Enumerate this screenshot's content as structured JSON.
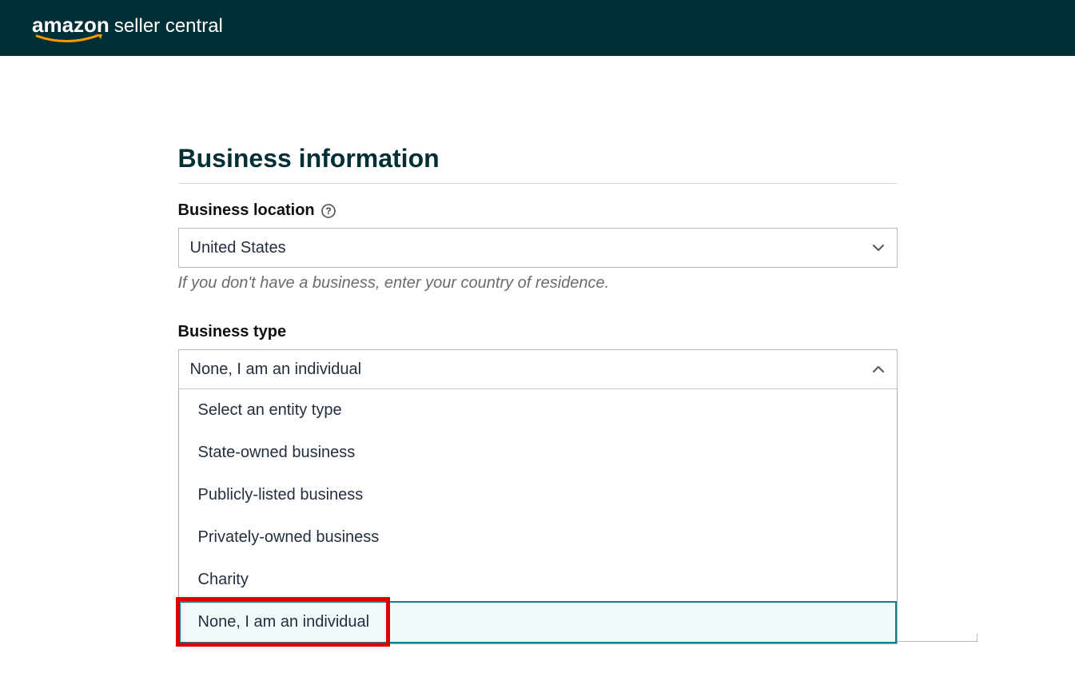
{
  "header": {
    "brand": "amazon",
    "product": "seller central"
  },
  "page": {
    "title": "Business information"
  },
  "fields": {
    "business_location": {
      "label": "Business location",
      "value": "United States",
      "hint": "If you don't have a business, enter your country of residence."
    },
    "business_type": {
      "label": "Business type",
      "value": "None, I am an individual",
      "options": [
        "Select an entity type",
        "State-owned business",
        "Publicly-listed business",
        "Privately-owned business",
        "Charity",
        "None, I am an individual"
      ],
      "selected_index": 5
    }
  }
}
